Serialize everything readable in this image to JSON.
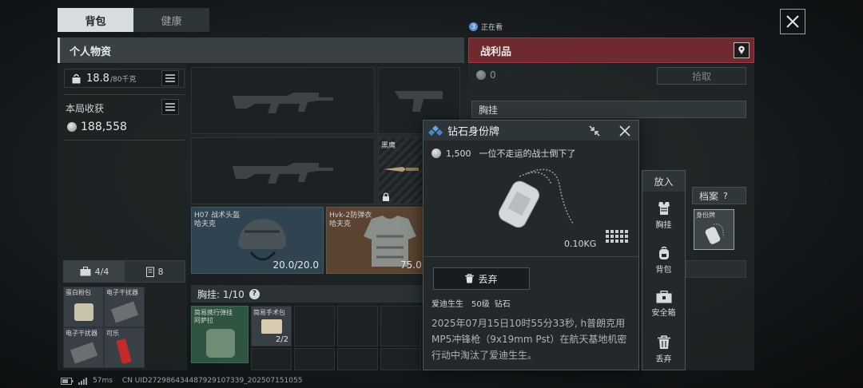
{
  "tabs": [
    {
      "label": "背包",
      "active": true
    },
    {
      "label": "健康",
      "active": false
    }
  ],
  "watching": {
    "count": "3",
    "label": "正在看"
  },
  "left": {
    "header": "个人物资",
    "weight_main": "18.8",
    "weight_max": "/80千克",
    "earnings_label": "本局收获",
    "earnings_value": "188,558"
  },
  "weapon_slots": {
    "knife_name": "黑鹰"
  },
  "gear": [
    {
      "name": "H07 战术头盔",
      "sub": "哈夫克",
      "durability": "20.0/20.0"
    },
    {
      "name": "Hvk-2防弹衣",
      "sub": "哈夫克",
      "durability": "75.0"
    }
  ],
  "containers": {
    "case_count": "4/4",
    "case_count2": "8",
    "items": [
      {
        "name": "蛋白粉包"
      },
      {
        "name": "电子干扰器"
      },
      {
        "name": "电子干扰器"
      },
      {
        "name": "可乐"
      }
    ]
  },
  "chest_rig": {
    "label": "胸挂: 1/10",
    "help": "?",
    "items": [
      {
        "name": "简易携行弹挂",
        "sub": "阿萨拉"
      },
      {
        "name": "简易手术包",
        "count": "2/2"
      }
    ]
  },
  "loot": {
    "header": "战利品",
    "value": "0",
    "pickup_label": "拾取",
    "chest_rig_label": "胸挂",
    "archive_label": "档案",
    "archive_help": "?",
    "dogtag_item": "身份牌"
  },
  "popup": {
    "title": "钻石身份牌",
    "price": "1,500",
    "desc": "一位不走运的战士倒下了",
    "weight": "0.10KG",
    "discard_label": "丢弃",
    "owner_name": "爱迪生生",
    "owner_level": "50级",
    "owner_rank": "钻石",
    "kill_text": "2025年07月15日10时55分33秒, h普朗克用MP5冲锋枪（9x19mm Pst）在航天基地机密行动中淘汰了爱迪生生。"
  },
  "side_menu": {
    "header": "放入",
    "items": [
      {
        "label": "胸挂",
        "icon": "vest-icon"
      },
      {
        "label": "背包",
        "icon": "backpack-icon"
      },
      {
        "label": "安全箱",
        "icon": "safebox-icon"
      },
      {
        "label": "丢弃",
        "icon": "trash-icon"
      }
    ]
  },
  "status_bar": {
    "ping": "57ms",
    "uid": "CN UID272986434487929107339_202507151055"
  },
  "colors": {
    "loot_header": "#6e2a2e",
    "accent_blue": "#5d8fd6",
    "helmet_bg": "#2f4450",
    "vest_bg": "#5a4330",
    "green_item": "#2f5540"
  }
}
